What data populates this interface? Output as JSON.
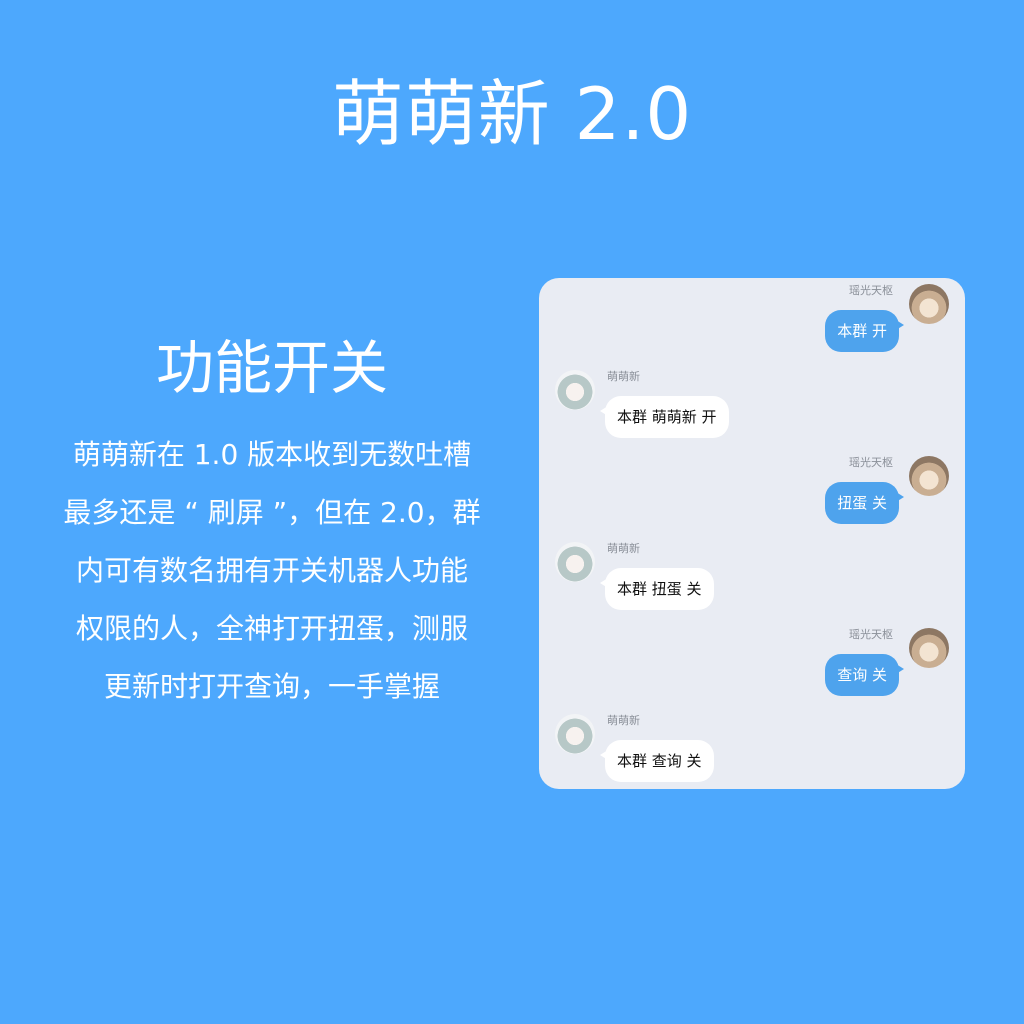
{
  "title": "萌萌新 2.0",
  "left_panel": {
    "subtitle": "功能开关",
    "lines": [
      "萌萌新在 1.0 版本收到无数吐槽",
      "最多还是 “ 刷屏 ”，但在 2.0，群",
      "内可有数名拥有开关机器人功能",
      "权限的人，全神打开扭蛋，测服",
      "更新时打开查询，一手掌握"
    ]
  },
  "chat": {
    "messages": [
      {
        "side": "right",
        "sender": "瑶光天枢",
        "text": "本群 开",
        "avatar": "cat-avatar"
      },
      {
        "side": "left",
        "sender": "萌萌新",
        "text": "本群 萌萌新 开",
        "avatar": "anime-girl-avatar"
      },
      {
        "side": "right",
        "sender": "瑶光天枢",
        "text": "扭蛋 关",
        "avatar": "cat-avatar"
      },
      {
        "side": "left",
        "sender": "萌萌新",
        "text": "本群 扭蛋 关",
        "avatar": "anime-girl-avatar"
      },
      {
        "side": "right",
        "sender": "瑶光天枢",
        "text": "查询 关",
        "avatar": "cat-avatar"
      },
      {
        "side": "left",
        "sender": "萌萌新",
        "text": "本群 查询 关",
        "avatar": "anime-girl-avatar"
      }
    ]
  }
}
